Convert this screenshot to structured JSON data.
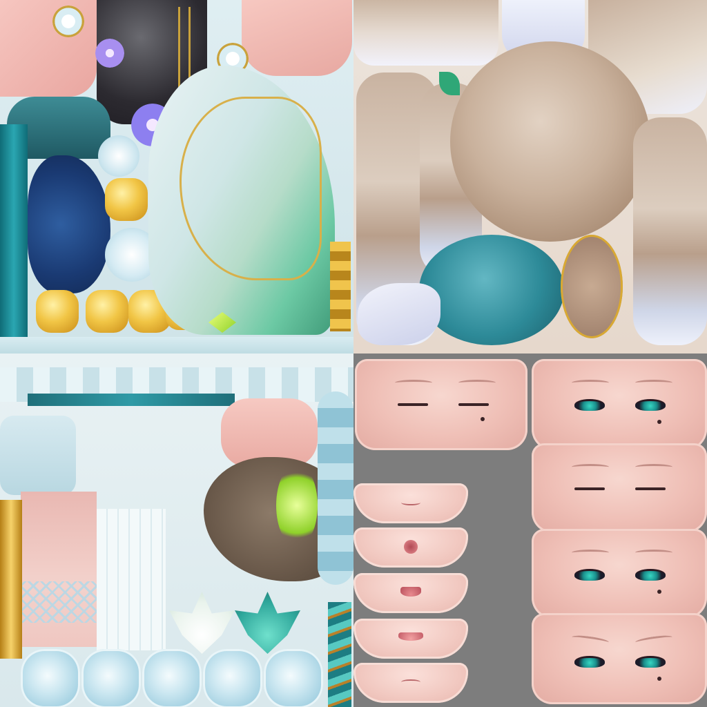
{
  "atlas": {
    "kind": "character texture atlas",
    "regions": [
      {
        "name": "outfit-upper"
      },
      {
        "name": "hair"
      },
      {
        "name": "outfit-lower"
      },
      {
        "name": "face-expressions"
      }
    ],
    "eye_expressions": [
      {
        "state": "closed",
        "has_mole": true
      },
      {
        "state": "open",
        "has_mole": true
      },
      {
        "state": "closed",
        "has_mole": false
      },
      {
        "state": "open",
        "has_mole": true
      },
      {
        "state": "open",
        "has_mole": true
      }
    ],
    "mouth_expressions": [
      {
        "shape": "smile-small"
      },
      {
        "shape": "o-shape"
      },
      {
        "shape": "open-smile"
      },
      {
        "shape": "open-wide"
      },
      {
        "shape": "small-frown"
      }
    ],
    "palette": {
      "skin": "#efbfb6",
      "teal": "#1a8f8c",
      "gold": "#d9a933",
      "hair": "#cbb6a3",
      "lilac": "#b7b1f0",
      "mint": "#6cc9a4",
      "background": "#7d7d7d"
    }
  }
}
